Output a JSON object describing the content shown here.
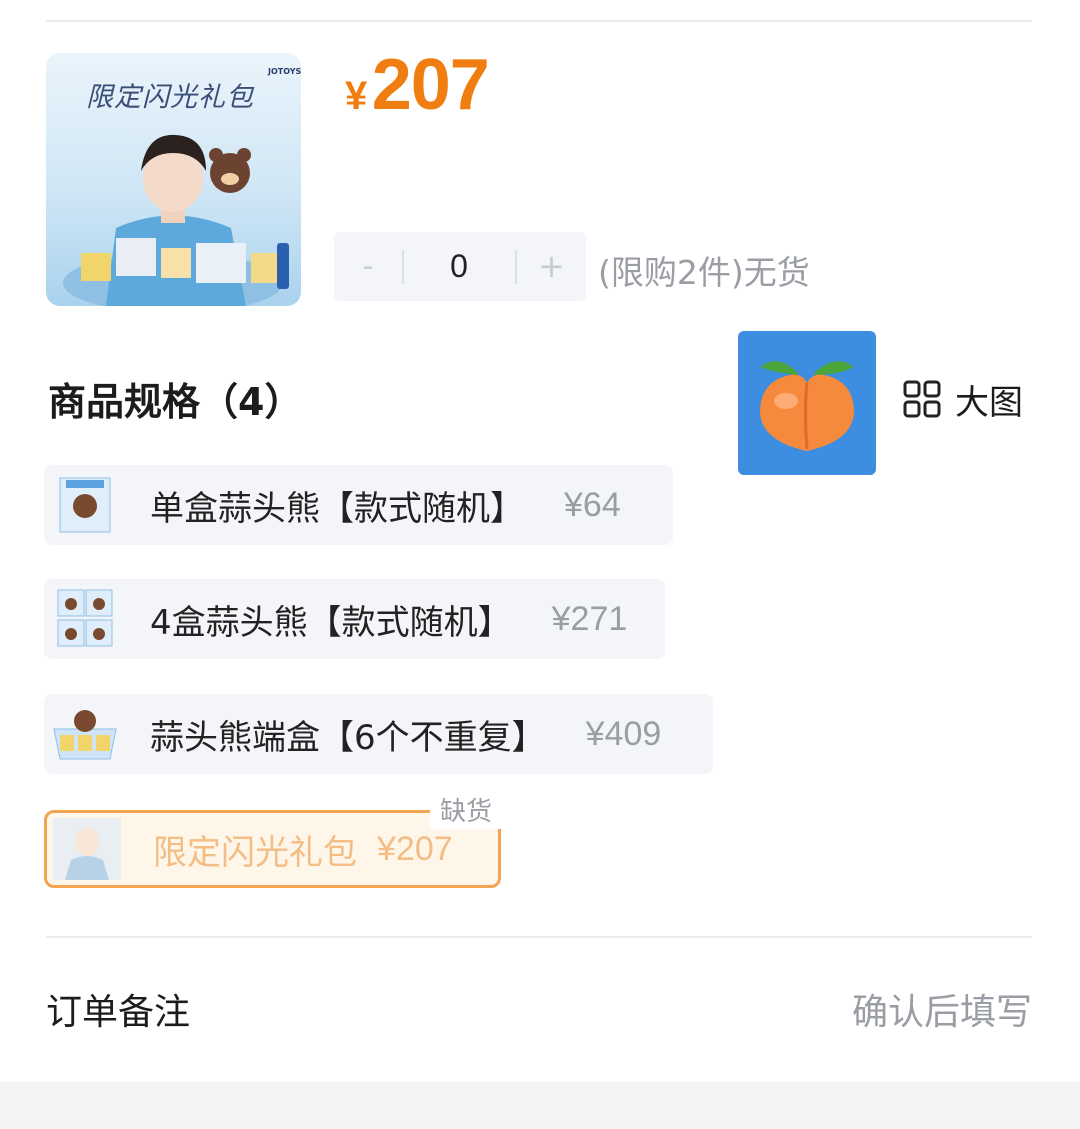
{
  "product": {
    "image_title": "限定闪光礼包",
    "image_brand": "JOTOYS",
    "currency": "¥",
    "price": "207"
  },
  "stepper": {
    "minus": "-",
    "quantity": "0",
    "plus": "+",
    "stock_note": "(限购2件)无货"
  },
  "specs": {
    "title": "商品规格（4）",
    "big_image_label": "大图",
    "items": [
      {
        "name": "单盒蒜头熊【款式随机】",
        "price": "¥64"
      },
      {
        "name": "4盒蒜头熊【款式随机】",
        "price": "¥271"
      },
      {
        "name": "蒜头熊端盒【6个不重复】",
        "price": "¥409"
      },
      {
        "name": "限定闪光礼包",
        "price": "¥207",
        "badge": "缺货"
      }
    ]
  },
  "remark": {
    "label": "订单备注",
    "value": "确认后填写"
  },
  "colors": {
    "accent": "#f07d10",
    "selected_border": "#f2a450",
    "muted": "#9a9ea4"
  }
}
